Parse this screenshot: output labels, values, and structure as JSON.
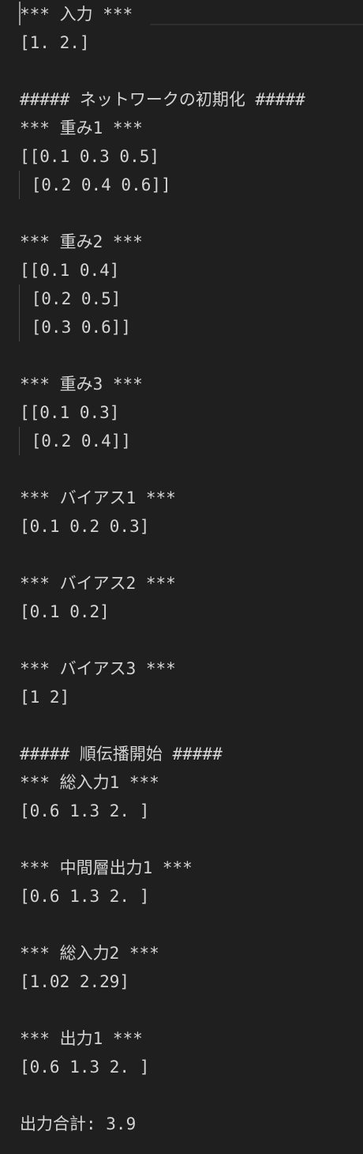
{
  "terminal": {
    "lines": [
      "*** 入力 ***",
      "[1. 2.]",
      "",
      "##### ネットワークの初期化 #####",
      "*** 重み1 ***",
      "[[0.1 0.3 0.5]",
      " [0.2 0.4 0.6]]",
      "",
      "*** 重み2 ***",
      "[[0.1 0.4]",
      " [0.2 0.5]",
      " [0.3 0.6]]",
      "",
      "*** 重み3 ***",
      "[[0.1 0.3]",
      " [0.2 0.4]]",
      "",
      "*** バイアス1 ***",
      "[0.1 0.2 0.3]",
      "",
      "*** バイアス2 ***",
      "[0.1 0.2]",
      "",
      "*** バイアス3 ***",
      "[1 2]",
      "",
      "##### 順伝播開始 #####",
      "*** 総入力1 ***",
      "[0.6 1.3 2. ]",
      "",
      "*** 中間層出力1 ***",
      "[0.6 1.3 2. ]",
      "",
      "*** 総入力2 ***",
      "[1.02 2.29]",
      "",
      "*** 出力1 ***",
      "[0.6 1.3 2. ]",
      "",
      "出力合計: 3.9"
    ]
  }
}
